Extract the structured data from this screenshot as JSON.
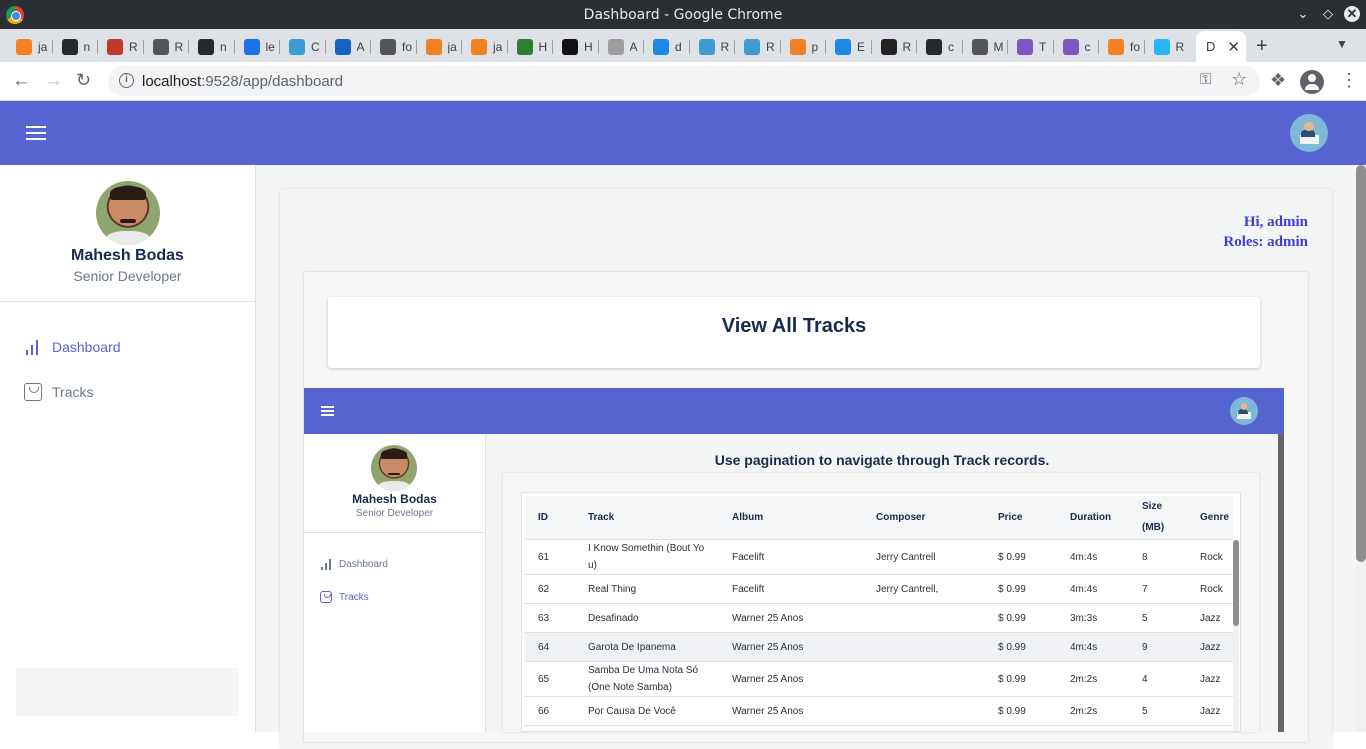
{
  "window": {
    "title": "Dashboard - Google Chrome",
    "controls": [
      "chevron-down",
      "diamond",
      "minimize",
      "close"
    ]
  },
  "tabs": [
    {
      "letter": "ja",
      "color": "#f48024",
      "icon": "stackoverflow-icon"
    },
    {
      "letter": "n",
      "color": "#24292e",
      "icon": "github-icon"
    },
    {
      "letter": "R",
      "color": "#c0392b",
      "icon": "s-logo-icon"
    },
    {
      "letter": "R",
      "color": "#555555",
      "icon": "globe-icon"
    },
    {
      "letter": "n",
      "color": "#24292e",
      "icon": "github-icon"
    },
    {
      "letter": "le",
      "color": "#1a73e8",
      "icon": "infinity-icon"
    },
    {
      "letter": "C",
      "color": "#3d9bd1",
      "icon": "mui-icon"
    },
    {
      "letter": "A",
      "color": "#1565c0",
      "icon": "hexagon-icon"
    },
    {
      "letter": "fo",
      "color": "#555555",
      "icon": "box-icon"
    },
    {
      "letter": "ja",
      "color": "#f48024",
      "icon": "stackoverflow-icon"
    },
    {
      "letter": "ja",
      "color": "#f48024",
      "icon": "stackoverflow-icon"
    },
    {
      "letter": "H",
      "color": "#2e7d32",
      "icon": "link-icon"
    },
    {
      "letter": "H",
      "color": "#111111",
      "icon": "hexagon-dark-icon"
    },
    {
      "letter": "A",
      "color": "#9e9e9e",
      "icon": "list-icon"
    },
    {
      "letter": "d",
      "color": "#1e88e5",
      "icon": "swirl-icon"
    },
    {
      "letter": "R",
      "color": "#3d9bd1",
      "icon": "mui-icon"
    },
    {
      "letter": "R",
      "color": "#3d9bd1",
      "icon": "mui-icon"
    },
    {
      "letter": "p",
      "color": "#f48024",
      "icon": "stackoverflow-icon"
    },
    {
      "letter": "E",
      "color": "#1e88e5",
      "icon": "e-circle-icon"
    },
    {
      "letter": "R",
      "color": "#222222",
      "icon": "react-icon"
    },
    {
      "letter": "c",
      "color": "#24292e",
      "icon": "github-icon"
    },
    {
      "letter": "M",
      "color": "#555555",
      "icon": "globe-icon"
    },
    {
      "letter": "T",
      "color": "#7e57c2",
      "icon": "h-box-icon"
    },
    {
      "letter": "c",
      "color": "#7e57c2",
      "icon": "h-box-icon"
    },
    {
      "letter": "fo",
      "color": "#f48024",
      "icon": "stackoverflow-icon"
    },
    {
      "letter": "R",
      "color": "#29b6f6",
      "icon": "c-hex-icon"
    }
  ],
  "active_tab": {
    "label": "D",
    "close": "✕"
  },
  "new_tab": "+",
  "address": {
    "host": "localhost",
    "rest": ":9528/app/dashboard"
  },
  "app": {
    "accent": "#5664d2",
    "user": {
      "name": "Mahesh Bodas",
      "role": "Senior Developer"
    },
    "nav": [
      {
        "label": "Dashboard",
        "icon": "bar-chart-icon",
        "active": true
      },
      {
        "label": "Tracks",
        "icon": "shopping-bag-icon",
        "active": false
      }
    ],
    "greeting": {
      "hi": "Hi, admin",
      "roles": "Roles: admin"
    },
    "page_title": "View All Tracks",
    "embedded": {
      "heading": "Use pagination to navigate through Track records.",
      "columns": [
        "ID",
        "Track",
        "Album",
        "Composer",
        "Price",
        "Duration",
        "Size",
        "(MB)",
        "Genre"
      ],
      "rows": [
        {
          "id": "61",
          "track": "I Know Somethin (Bout Yo",
          "track2": "u)",
          "album": "Facelift",
          "composer": "Jerry Cantrell",
          "price": "$ 0.99",
          "duration": "4m:4s",
          "size": "8",
          "genre": "Rock"
        },
        {
          "id": "62",
          "track": "Real Thing",
          "track2": "",
          "album": "Facelift",
          "composer": "Jerry Cantrell,",
          "price": "$ 0.99",
          "duration": "4m:4s",
          "size": "7",
          "genre": "Rock"
        },
        {
          "id": "63",
          "track": "Desafinado",
          "track2": "",
          "album": "Warner 25 Anos",
          "composer": "",
          "price": "$ 0.99",
          "duration": "3m:3s",
          "size": "5",
          "genre": "Jazz"
        },
        {
          "id": "64",
          "track": "Garota De Ipanema",
          "track2": "",
          "album": "Warner 25 Anos",
          "composer": "",
          "price": "$ 0.99",
          "duration": "4m:4s",
          "size": "9",
          "genre": "Jazz"
        },
        {
          "id": "65",
          "track": "Samba De Uma Nota Só",
          "track2": "(One Note Samba)",
          "album": "Warner 25 Anos",
          "composer": "",
          "price": "$ 0.99",
          "duration": "2m:2s",
          "size": "4",
          "genre": "Jazz"
        },
        {
          "id": "66",
          "track": "Por Causa De Você",
          "track2": "",
          "album": "Warner 25 Anos",
          "composer": "",
          "price": "$ 0.99",
          "duration": "2m:2s",
          "size": "5",
          "genre": "Jazz"
        }
      ]
    }
  }
}
